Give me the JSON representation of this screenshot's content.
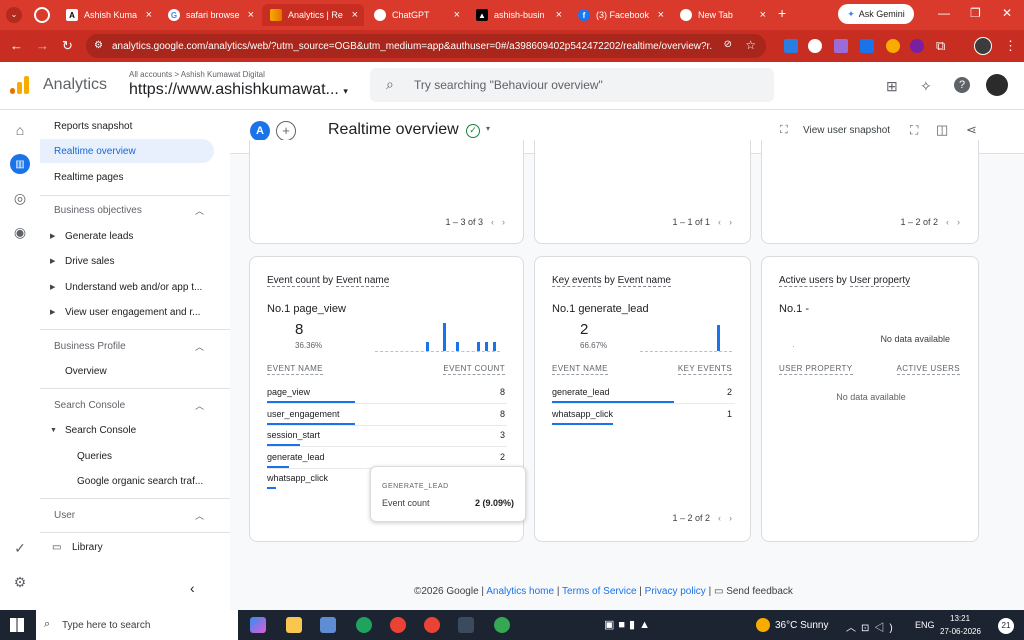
{
  "browser": {
    "tabs": [
      {
        "label": "Ashish Kuma",
        "icon": "website-icon",
        "active": false
      },
      {
        "label": "safari browse",
        "icon": "google-icon",
        "active": false
      },
      {
        "label": "Analytics | Re",
        "icon": "analytics-icon",
        "active": true
      },
      {
        "label": "ChatGPT",
        "icon": "chatgpt-icon",
        "active": false
      },
      {
        "label": "ashish-busin",
        "icon": "website-icon",
        "active": false
      },
      {
        "label": "(3) Facebook",
        "icon": "facebook-icon",
        "active": false
      },
      {
        "label": "New Tab",
        "icon": "chrome-icon",
        "active": false
      }
    ],
    "ask_gemini": "Ask Gemini",
    "url": "analytics.google.com/analytics/web/?utm_source=OGB&utm_medium=app&authuser=0#/a398609402p542472202/realtime/overview?r..."
  },
  "header": {
    "product": "Analytics",
    "breadcrumb": "All accounts > Ashish Kumawat Digital",
    "property": "https://www.ashishkumawat...",
    "search_placeholder": "Try searching \"Behaviour overview\""
  },
  "nav": {
    "reports_snapshot": "Reports snapshot",
    "realtime_overview": "Realtime overview",
    "realtime_pages": "Realtime pages",
    "business_objectives": "Business objectives",
    "generate_leads": "Generate leads",
    "drive_sales": "Drive sales",
    "understand": "Understand web and/or app t...",
    "view_engagement": "View user engagement and r...",
    "business_profile": "Business Profile",
    "overview": "Overview",
    "search_console_section": "Search Console",
    "search_console": "Search Console",
    "queries": "Queries",
    "organic": "Google organic search traf...",
    "user": "User",
    "library": "Library"
  },
  "titlebar": {
    "avatar": "A",
    "title": "Realtime overview",
    "view_snapshot": "View user snapshot"
  },
  "top_cards": {
    "pager1": "1 – 3 of 3",
    "pager2": "1 – 1 of 1",
    "pager3": "1 – 2 of 2"
  },
  "event_card": {
    "title_a": "Event count",
    "title_by": " by ",
    "title_b": "Event name",
    "top_rank": "No.1",
    "top_name": "page_view",
    "top_value": "8",
    "top_pct": "36.36%",
    "col1": "EVENT NAME",
    "col2": "EVENT COUNT",
    "rows": [
      {
        "name": "page_view",
        "count": "8",
        "share": 1.0
      },
      {
        "name": "user_engagement",
        "count": "8",
        "share": 1.0
      },
      {
        "name": "session_start",
        "count": "3",
        "share": 0.375
      },
      {
        "name": "generate_lead",
        "count": "2",
        "share": 0.25
      },
      {
        "name": "whatsapp_click",
        "count": "",
        "share": 0.1
      }
    ],
    "tooltip_header": "GENERATE_LEAD",
    "tooltip_label": "Event count",
    "tooltip_value": "2 (9.09%)"
  },
  "key_card": {
    "title_a": "Key events",
    "title_by": " by ",
    "title_b": "Event name",
    "top_rank": "No.1",
    "top_name": "generate_lead",
    "top_value": "2",
    "top_pct": "66.67%",
    "col1": "EVENT NAME",
    "col2": "KEY EVENTS",
    "rows": [
      {
        "name": "generate_lead",
        "count": "2",
        "share": 1.0
      },
      {
        "name": "whatsapp_click",
        "count": "1",
        "share": 0.5
      }
    ],
    "pager": "1 – 2 of 2"
  },
  "user_card": {
    "title_a": "Active users",
    "title_by": " by ",
    "title_b": "User property",
    "top_rank": "No.1",
    "top_name": "-",
    "no_data": "No data available",
    "col1": "USER PROPERTY",
    "col2": "ACTIVE USERS",
    "no_data_table": "No data available"
  },
  "footer": {
    "copyright": "©2026 Google | ",
    "analytics_home": "Analytics home",
    "sep": " | ",
    "terms": "Terms of Service",
    "privacy": "Privacy policy",
    "feedback": "Send feedback"
  },
  "taskbar": {
    "search": "Type here to search",
    "weather": "36°C  Sunny",
    "lang": "ENG",
    "time": "13:21",
    "date": "27-06-2026",
    "notif": "21"
  },
  "colors": {
    "accent": "#1a73e8",
    "browser": "#d93a2b",
    "analytics_orange": "#f9ab00"
  }
}
